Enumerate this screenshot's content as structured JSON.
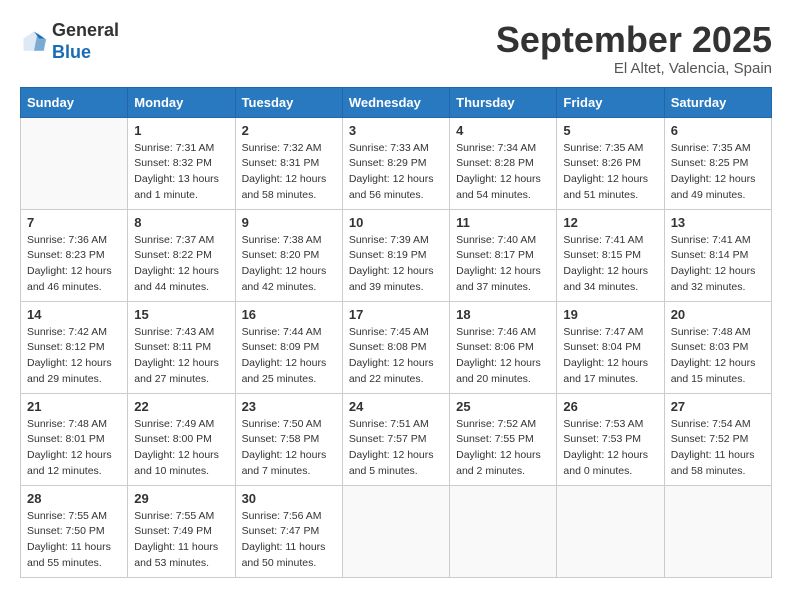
{
  "header": {
    "logo_general": "General",
    "logo_blue": "Blue",
    "month_title": "September 2025",
    "location": "El Altet, Valencia, Spain"
  },
  "weekdays": [
    "Sunday",
    "Monday",
    "Tuesday",
    "Wednesday",
    "Thursday",
    "Friday",
    "Saturday"
  ],
  "weeks": [
    [
      {
        "day": "",
        "info": ""
      },
      {
        "day": "1",
        "info": "Sunrise: 7:31 AM\nSunset: 8:32 PM\nDaylight: 13 hours\nand 1 minute."
      },
      {
        "day": "2",
        "info": "Sunrise: 7:32 AM\nSunset: 8:31 PM\nDaylight: 12 hours\nand 58 minutes."
      },
      {
        "day": "3",
        "info": "Sunrise: 7:33 AM\nSunset: 8:29 PM\nDaylight: 12 hours\nand 56 minutes."
      },
      {
        "day": "4",
        "info": "Sunrise: 7:34 AM\nSunset: 8:28 PM\nDaylight: 12 hours\nand 54 minutes."
      },
      {
        "day": "5",
        "info": "Sunrise: 7:35 AM\nSunset: 8:26 PM\nDaylight: 12 hours\nand 51 minutes."
      },
      {
        "day": "6",
        "info": "Sunrise: 7:35 AM\nSunset: 8:25 PM\nDaylight: 12 hours\nand 49 minutes."
      }
    ],
    [
      {
        "day": "7",
        "info": "Sunrise: 7:36 AM\nSunset: 8:23 PM\nDaylight: 12 hours\nand 46 minutes."
      },
      {
        "day": "8",
        "info": "Sunrise: 7:37 AM\nSunset: 8:22 PM\nDaylight: 12 hours\nand 44 minutes."
      },
      {
        "day": "9",
        "info": "Sunrise: 7:38 AM\nSunset: 8:20 PM\nDaylight: 12 hours\nand 42 minutes."
      },
      {
        "day": "10",
        "info": "Sunrise: 7:39 AM\nSunset: 8:19 PM\nDaylight: 12 hours\nand 39 minutes."
      },
      {
        "day": "11",
        "info": "Sunrise: 7:40 AM\nSunset: 8:17 PM\nDaylight: 12 hours\nand 37 minutes."
      },
      {
        "day": "12",
        "info": "Sunrise: 7:41 AM\nSunset: 8:15 PM\nDaylight: 12 hours\nand 34 minutes."
      },
      {
        "day": "13",
        "info": "Sunrise: 7:41 AM\nSunset: 8:14 PM\nDaylight: 12 hours\nand 32 minutes."
      }
    ],
    [
      {
        "day": "14",
        "info": "Sunrise: 7:42 AM\nSunset: 8:12 PM\nDaylight: 12 hours\nand 29 minutes."
      },
      {
        "day": "15",
        "info": "Sunrise: 7:43 AM\nSunset: 8:11 PM\nDaylight: 12 hours\nand 27 minutes."
      },
      {
        "day": "16",
        "info": "Sunrise: 7:44 AM\nSunset: 8:09 PM\nDaylight: 12 hours\nand 25 minutes."
      },
      {
        "day": "17",
        "info": "Sunrise: 7:45 AM\nSunset: 8:08 PM\nDaylight: 12 hours\nand 22 minutes."
      },
      {
        "day": "18",
        "info": "Sunrise: 7:46 AM\nSunset: 8:06 PM\nDaylight: 12 hours\nand 20 minutes."
      },
      {
        "day": "19",
        "info": "Sunrise: 7:47 AM\nSunset: 8:04 PM\nDaylight: 12 hours\nand 17 minutes."
      },
      {
        "day": "20",
        "info": "Sunrise: 7:48 AM\nSunset: 8:03 PM\nDaylight: 12 hours\nand 15 minutes."
      }
    ],
    [
      {
        "day": "21",
        "info": "Sunrise: 7:48 AM\nSunset: 8:01 PM\nDaylight: 12 hours\nand 12 minutes."
      },
      {
        "day": "22",
        "info": "Sunrise: 7:49 AM\nSunset: 8:00 PM\nDaylight: 12 hours\nand 10 minutes."
      },
      {
        "day": "23",
        "info": "Sunrise: 7:50 AM\nSunset: 7:58 PM\nDaylight: 12 hours\nand 7 minutes."
      },
      {
        "day": "24",
        "info": "Sunrise: 7:51 AM\nSunset: 7:57 PM\nDaylight: 12 hours\nand 5 minutes."
      },
      {
        "day": "25",
        "info": "Sunrise: 7:52 AM\nSunset: 7:55 PM\nDaylight: 12 hours\nand 2 minutes."
      },
      {
        "day": "26",
        "info": "Sunrise: 7:53 AM\nSunset: 7:53 PM\nDaylight: 12 hours\nand 0 minutes."
      },
      {
        "day": "27",
        "info": "Sunrise: 7:54 AM\nSunset: 7:52 PM\nDaylight: 11 hours\nand 58 minutes."
      }
    ],
    [
      {
        "day": "28",
        "info": "Sunrise: 7:55 AM\nSunset: 7:50 PM\nDaylight: 11 hours\nand 55 minutes."
      },
      {
        "day": "29",
        "info": "Sunrise: 7:55 AM\nSunset: 7:49 PM\nDaylight: 11 hours\nand 53 minutes."
      },
      {
        "day": "30",
        "info": "Sunrise: 7:56 AM\nSunset: 7:47 PM\nDaylight: 11 hours\nand 50 minutes."
      },
      {
        "day": "",
        "info": ""
      },
      {
        "day": "",
        "info": ""
      },
      {
        "day": "",
        "info": ""
      },
      {
        "day": "",
        "info": ""
      }
    ]
  ]
}
